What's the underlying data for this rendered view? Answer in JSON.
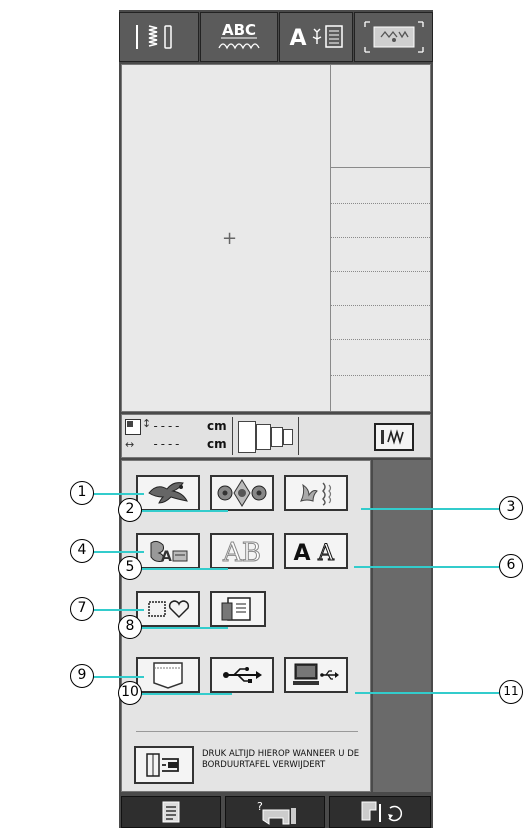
{
  "tabs": [
    {
      "name": "tab-stitch-patterns",
      "icon": "stitch-pattern-icon"
    },
    {
      "name": "tab-character-decorative",
      "icon": "abc-character-icon",
      "label": "ABC"
    },
    {
      "name": "tab-embroidery-letters",
      "icon": "letter-embroidery-icon",
      "label": "A"
    },
    {
      "name": "tab-embroidery",
      "icon": "embroidery-hoop-icon"
    }
  ],
  "size_display": {
    "height_value": "----",
    "height_unit": "cm",
    "width_value": "----",
    "width_unit": "cm"
  },
  "menu": {
    "buttons": [
      {
        "id": 1,
        "name": "embroidery-patterns-button",
        "icon": "bird-embroidery-icon"
      },
      {
        "id": 2,
        "name": "floral-alphabet-button",
        "icon": "floral-pattern-icon"
      },
      {
        "id": 3,
        "name": "character-designs-button",
        "icon": "flower-design-icon"
      },
      {
        "id": 4,
        "name": "brother-exclusive-button",
        "icon": "appliqué-icon"
      },
      {
        "id": 5,
        "name": "outline-alphabet-button",
        "icon": "outline-letters-icon",
        "label": "AB"
      },
      {
        "id": 6,
        "name": "alphabet-characters-button",
        "icon": "alphabet-icon",
        "label": "A"
      },
      {
        "id": 7,
        "name": "frame-patterns-button",
        "icon": "frame-heart-icon"
      },
      {
        "id": 8,
        "name": "embroidery-card-button",
        "icon": "memory-card-icon"
      },
      {
        "id": 9,
        "name": "machine-memory-button",
        "icon": "pocket-memory-icon"
      },
      {
        "id": 10,
        "name": "usb-media-button",
        "icon": "usb-icon"
      },
      {
        "id": 11,
        "name": "computer-usb-button",
        "icon": "computer-usb-icon"
      }
    ],
    "remove_note": "DRUK ALTIJD HIEROP WANNEER U DE BORDUURTAFEL VERWIJDERT"
  },
  "callout_numbers": [
    "1",
    "2",
    "3",
    "4",
    "5",
    "6",
    "7",
    "8",
    "9",
    "10",
    "11"
  ],
  "bottom_bar": [
    {
      "name": "settings-button",
      "icon": "settings-list-icon"
    },
    {
      "name": "help-button",
      "icon": "help-machine-icon",
      "label": "?"
    },
    {
      "name": "presser-foot-button",
      "icon": "presser-foot-icon"
    }
  ],
  "colors": {
    "accent_callout": "#33cccc",
    "screen_dark": "#4a4a4a",
    "panel_light": "#e4e4e4"
  }
}
